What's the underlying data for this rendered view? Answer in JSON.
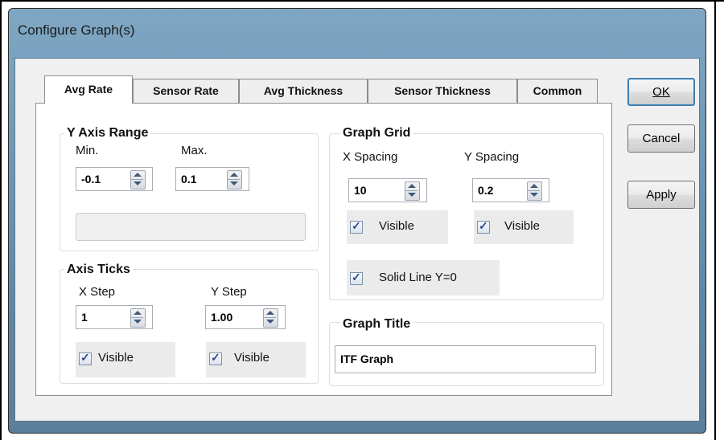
{
  "window": {
    "title": "Configure Graph(s)"
  },
  "tabs": [
    {
      "label": "Avg Rate",
      "active": true
    },
    {
      "label": "Sensor Rate",
      "active": false
    },
    {
      "label": "Avg Thickness",
      "active": false
    },
    {
      "label": "Sensor Thickness",
      "active": false
    },
    {
      "label": "Common",
      "active": false
    }
  ],
  "y_axis_range": {
    "title": "Y Axis Range",
    "min_label": "Min.",
    "min_value": "-0.1",
    "max_label": "Max.",
    "max_value": "0.1",
    "extra_value": ""
  },
  "axis_ticks": {
    "title": "Axis Ticks",
    "x_step_label": "X Step",
    "x_step_value": "1",
    "y_step_label": "Y Step",
    "y_step_value": "1.00",
    "x_visible_label": "Visible",
    "x_visible_checked": true,
    "y_visible_label": "Visible",
    "y_visible_checked": true
  },
  "graph_grid": {
    "title": "Graph Grid",
    "x_spacing_label": "X Spacing",
    "x_spacing_value": "10",
    "y_spacing_label": "Y Spacing",
    "y_spacing_value": "0.2",
    "x_visible_label": "Visible",
    "x_visible_checked": true,
    "y_visible_label": "Visible",
    "y_visible_checked": true,
    "solid_line_label": "Solid Line Y=0",
    "solid_line_checked": true
  },
  "graph_title": {
    "title": "Graph Title",
    "value": "ITF Graph"
  },
  "buttons": {
    "ok_label": "OK",
    "cancel_label": "Cancel",
    "apply_label": "Apply"
  }
}
